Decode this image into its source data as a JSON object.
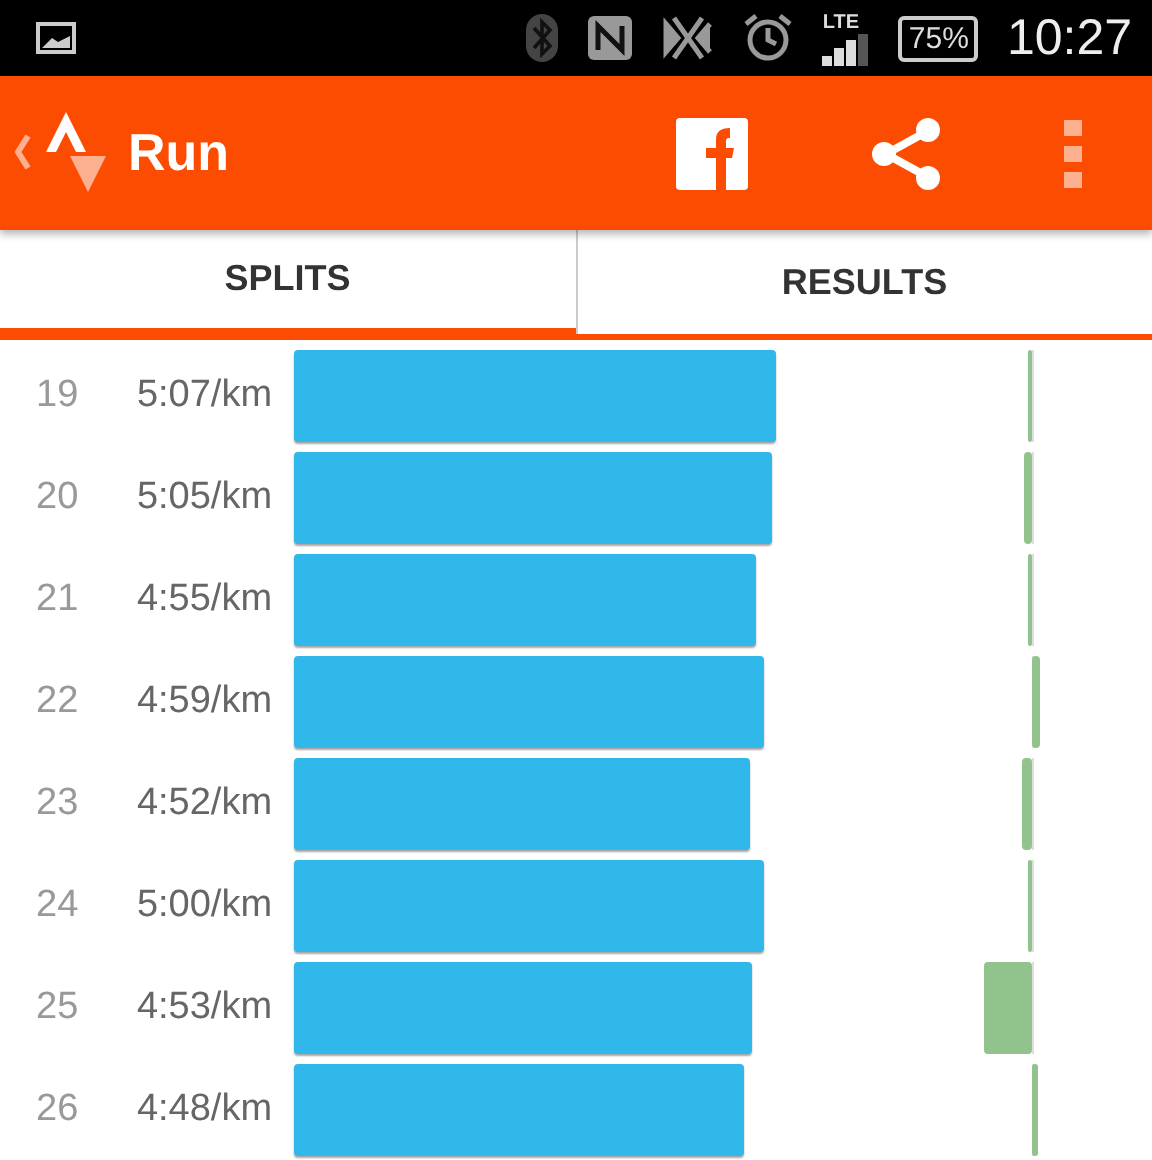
{
  "status_bar": {
    "network": "LTE",
    "battery": "75%",
    "time": "10:27"
  },
  "toolbar": {
    "title": "Run"
  },
  "tabs": [
    {
      "label": "SPLITS",
      "selected": true
    },
    {
      "label": "RESULTS",
      "selected": false
    }
  ],
  "splits": [
    {
      "number": "19",
      "pace": "5:07/km"
    },
    {
      "number": "20",
      "pace": "5:05/km"
    },
    {
      "number": "21",
      "pace": "4:55/km"
    },
    {
      "number": "22",
      "pace": "4:59/km"
    },
    {
      "number": "23",
      "pace": "4:52/km"
    },
    {
      "number": "24",
      "pace": "5:00/km"
    },
    {
      "number": "25",
      "pace": "4:53/km"
    },
    {
      "number": "26",
      "pace": "4:48/km"
    }
  ]
}
